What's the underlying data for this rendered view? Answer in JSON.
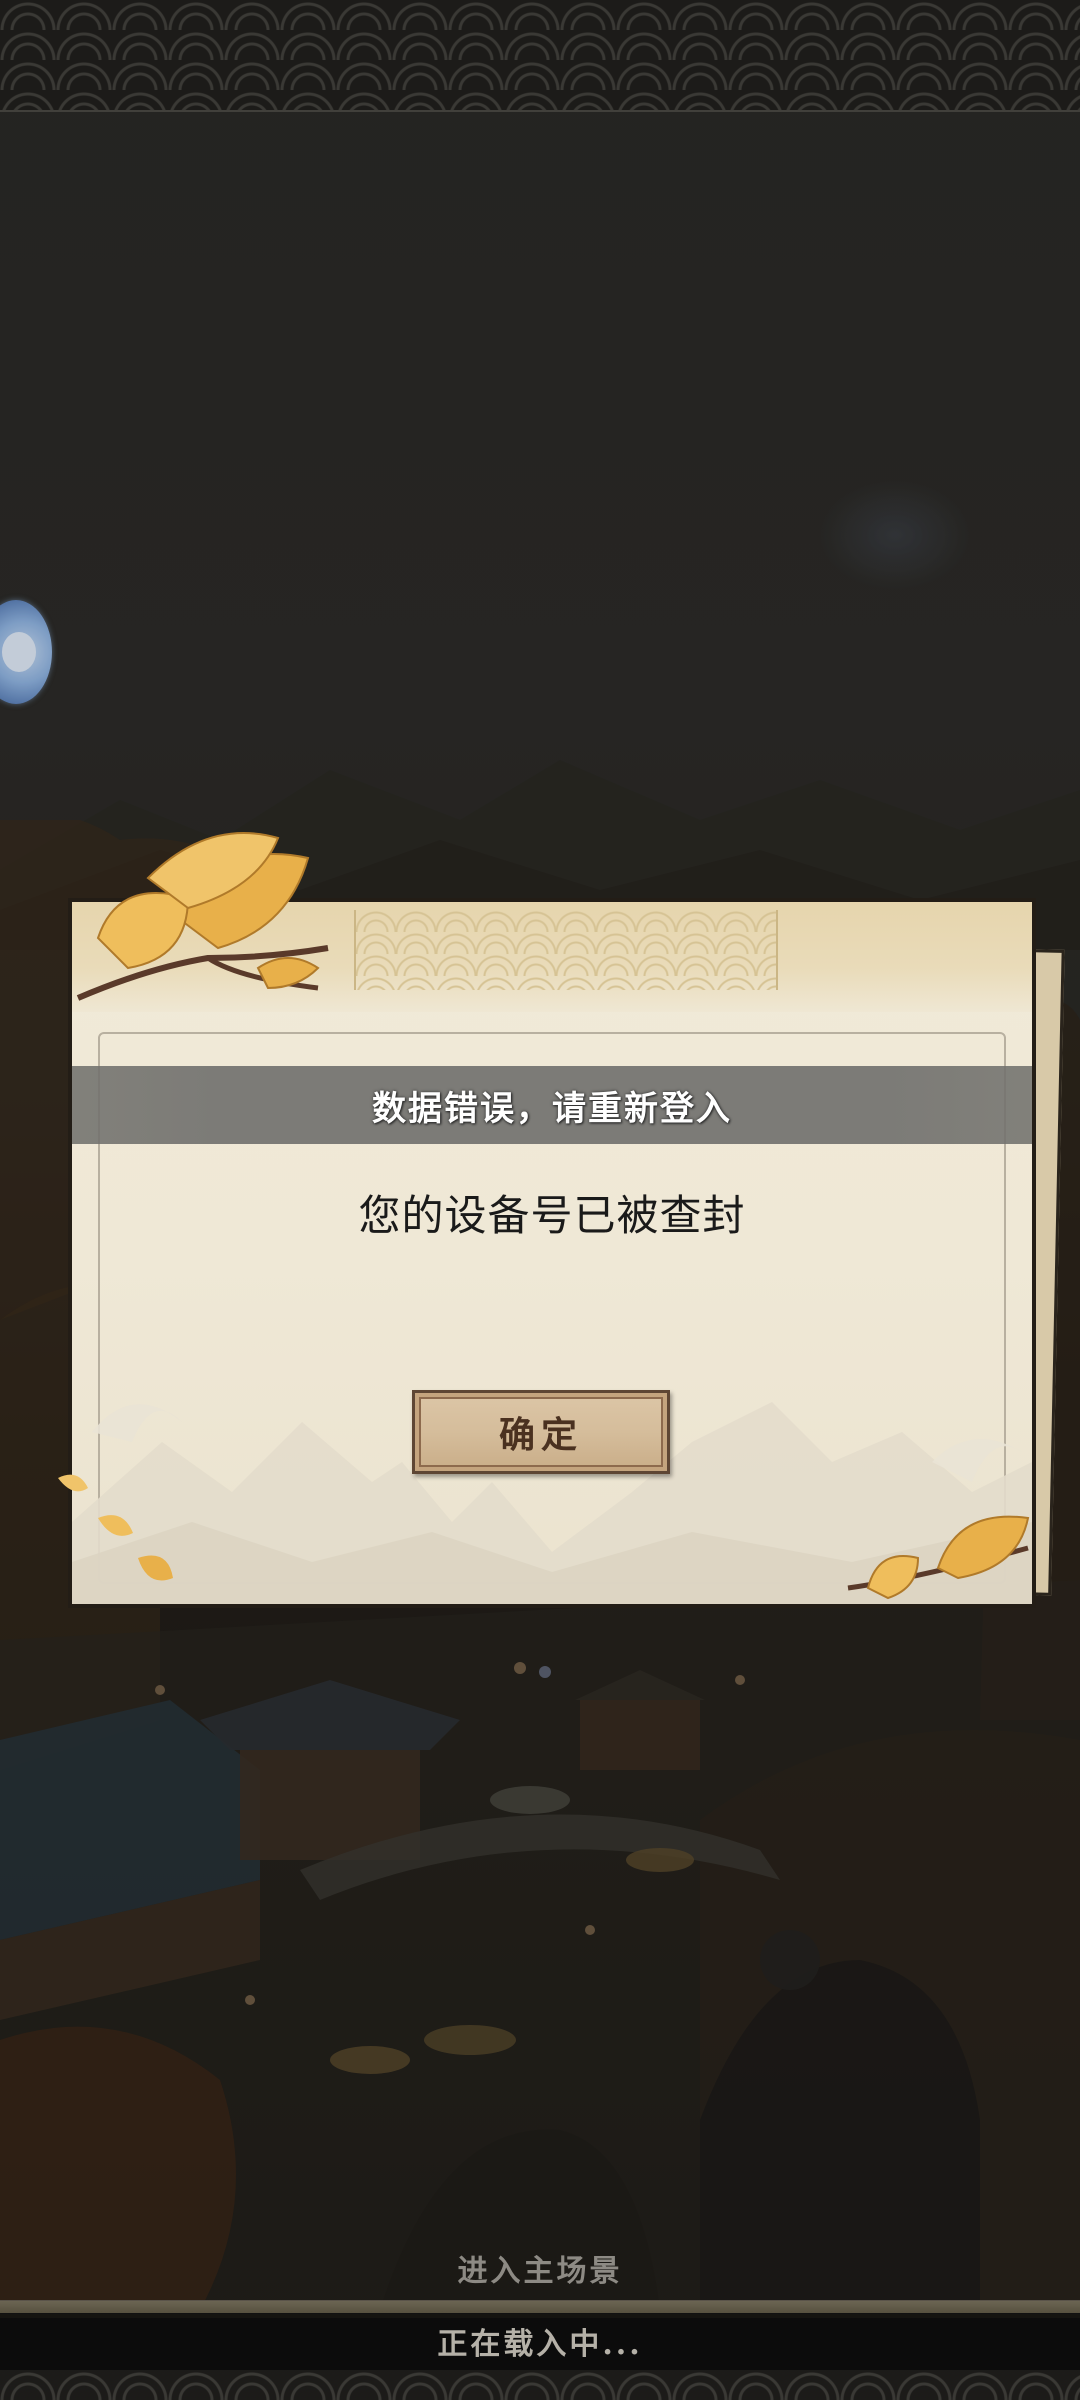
{
  "dialog": {
    "title": "数据错误，请重新登入",
    "message": "您的设备号已被查封",
    "confirm_label": "确定"
  },
  "loading": {
    "scene_label": "进入主场景",
    "status_text": "正在载入中...",
    "progress_fraction": 1.0
  },
  "colors": {
    "panel_background": "#efe8d6",
    "title_bar": "#7c7b77",
    "button_background": "#d5bd9b",
    "ginkgo_leaf": "#e8b04a"
  },
  "icons": {
    "side_float": "floating-assistant-icon",
    "leaves": "ginkgo-leaf-icon"
  }
}
